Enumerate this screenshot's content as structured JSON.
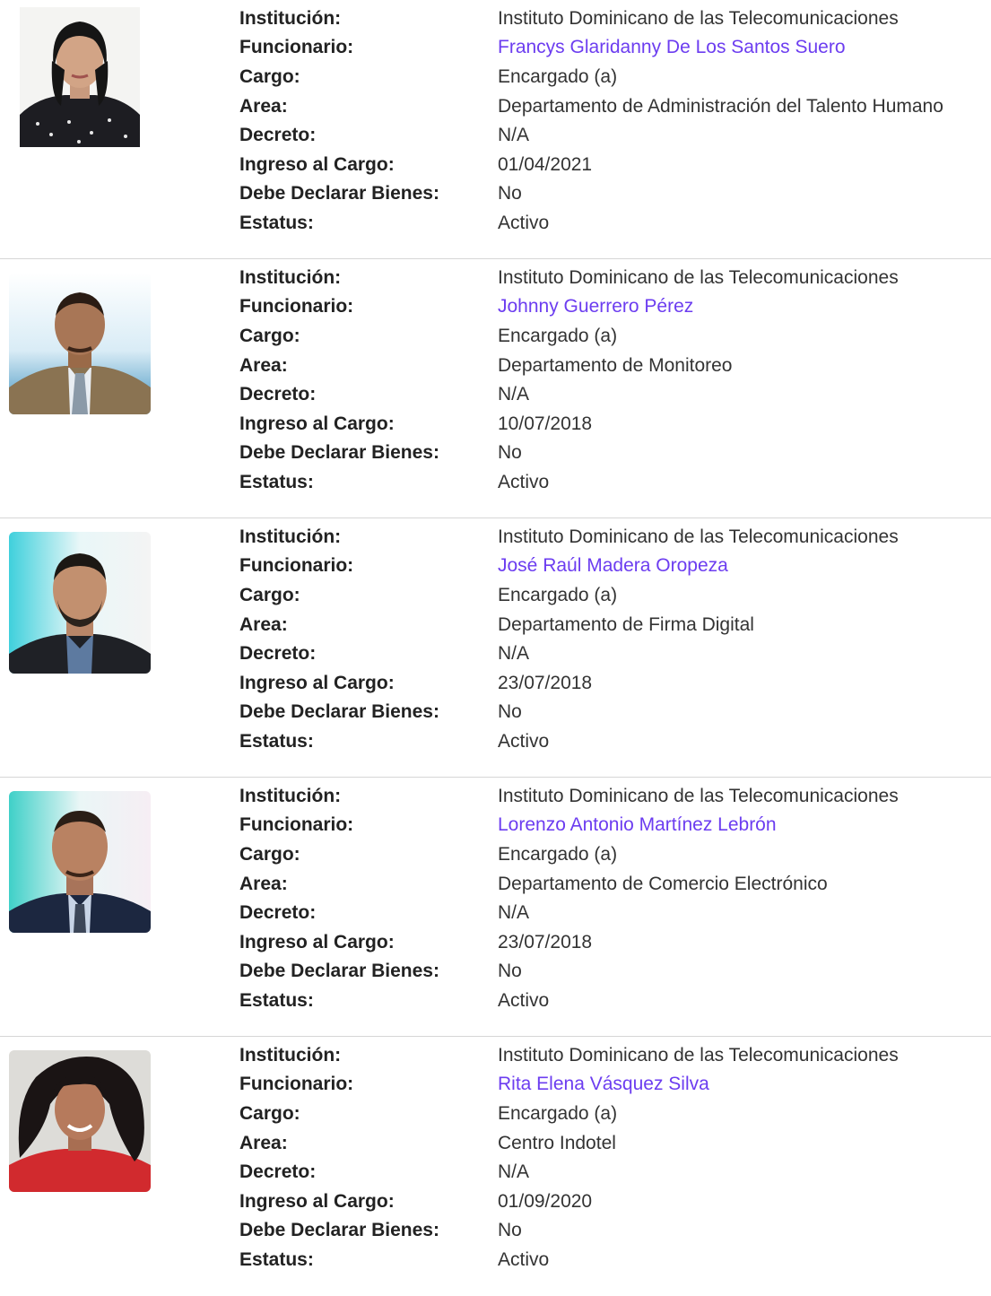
{
  "labels": {
    "institucion": "Institución:",
    "funcionario": "Funcionario:",
    "cargo": "Cargo:",
    "area": "Area:",
    "decreto": "Decreto:",
    "ingreso": "Ingreso al Cargo:",
    "declarar": "Debe Declarar Bienes:",
    "estatus": "Estatus:"
  },
  "colors": {
    "link": "#6c3df0",
    "divider": "#d6d6d6"
  },
  "officials": [
    {
      "institucion": "Instituto Dominicano de las Telecomunicaciones",
      "funcionario": "Francys Glaridanny De Los Santos Suero",
      "cargo": "Encargado (a)",
      "area": "Departamento de Administración del Talento Humano",
      "decreto": "N/A",
      "ingreso": "01/04/2021",
      "declarar": "No",
      "estatus": "Activo"
    },
    {
      "institucion": "Instituto Dominicano de las Telecomunicaciones",
      "funcionario": "Johnny Guerrero Pérez",
      "cargo": "Encargado (a)",
      "area": "Departamento de Monitoreo",
      "decreto": "N/A",
      "ingreso": "10/07/2018",
      "declarar": "No",
      "estatus": "Activo"
    },
    {
      "institucion": "Instituto Dominicano de las Telecomunicaciones",
      "funcionario": "José Raúl Madera Oropeza",
      "cargo": "Encargado (a)",
      "area": "Departamento de Firma Digital",
      "decreto": "N/A",
      "ingreso": "23/07/2018",
      "declarar": "No",
      "estatus": "Activo"
    },
    {
      "institucion": "Instituto Dominicano de las Telecomunicaciones",
      "funcionario": "Lorenzo Antonio Martínez Lebrón",
      "cargo": "Encargado (a)",
      "area": "Departamento de Comercio Electrónico",
      "decreto": "N/A",
      "ingreso": "23/07/2018",
      "declarar": "No",
      "estatus": "Activo"
    },
    {
      "institucion": "Instituto Dominicano de las Telecomunicaciones",
      "funcionario": "Rita Elena Vásquez Silva",
      "cargo": "Encargado (a)",
      "area": "Centro Indotel",
      "decreto": "N/A",
      "ingreso": "01/09/2020",
      "declarar": "No",
      "estatus": "Activo"
    }
  ]
}
